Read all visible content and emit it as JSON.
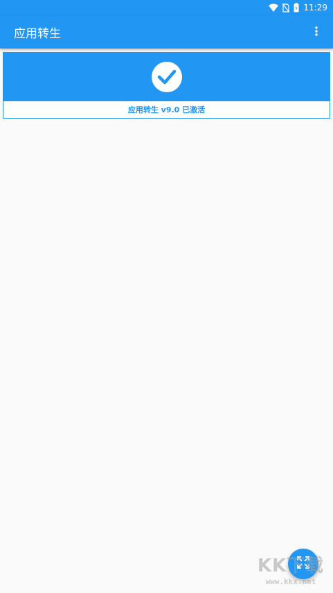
{
  "status_bar": {
    "time": "11:29",
    "icons": [
      "wifi-icon",
      "no-sim-icon",
      "battery-icon"
    ]
  },
  "app_bar": {
    "title": "应用转生",
    "menu_icon": "more-vert-icon"
  },
  "status_card": {
    "icon": "check-icon",
    "label": "应用转生 v9.0 已激活"
  },
  "fab": {
    "icon": "expand-icon"
  },
  "watermark": {
    "brand": "KK下载",
    "url": "www.kkx.net"
  },
  "colors": {
    "primary": "#2196f3",
    "background": "#fafafa",
    "surface": "#ffffff"
  }
}
